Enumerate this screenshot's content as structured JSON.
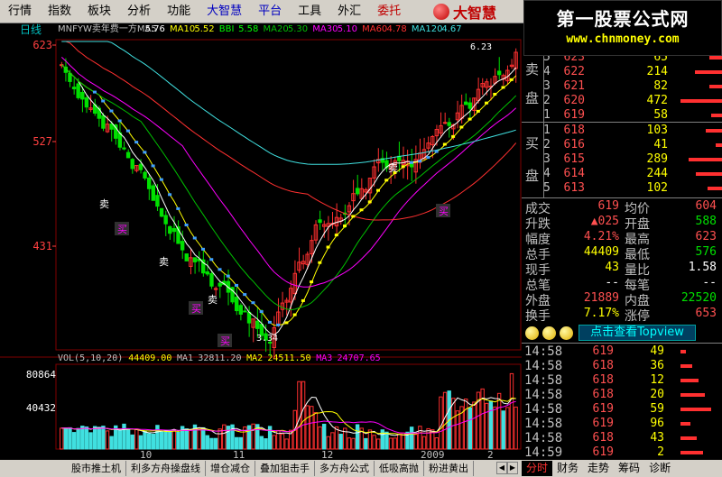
{
  "menu": {
    "items": [
      {
        "label": "行情",
        "style": ""
      },
      {
        "label": "指数",
        "style": ""
      },
      {
        "label": "板块",
        "style": ""
      },
      {
        "label": "分析",
        "style": ""
      },
      {
        "label": "功能",
        "style": ""
      },
      {
        "label": "大智慧",
        "style": "blue"
      },
      {
        "label": "平台",
        "style": "blue"
      },
      {
        "label": "工具",
        "style": ""
      },
      {
        "label": "外汇",
        "style": ""
      },
      {
        "label": "委托",
        "style": "red"
      }
    ],
    "brand": "大智慧"
  },
  "watermark": {
    "title": "第一股票公式网",
    "url": "www.chnmoney.com"
  },
  "chart": {
    "period_label": "日线",
    "indicator_header": [
      {
        "text": "MNFYW卖年费一方MA5",
        "color": "#c0c0c0"
      },
      {
        "text": "5.76",
        "color": "#ffffff"
      },
      {
        "text": "MA10",
        "color": "#ffff00"
      },
      {
        "text": "5.52",
        "color": "#ffff00"
      },
      {
        "text": "BBI",
        "color": "#00ff00"
      },
      {
        "text": "5.58",
        "color": "#00ff00"
      },
      {
        "text": "MA20",
        "color": "#00c000"
      },
      {
        "text": "5.30",
        "color": "#00c000"
      },
      {
        "text": "MA30",
        "color": "#ff00ff"
      },
      {
        "text": "5.10",
        "color": "#ff00ff"
      },
      {
        "text": "MA60",
        "color": "#ff3030"
      },
      {
        "text": "4.78",
        "color": "#ff3030"
      },
      {
        "text": "MA120",
        "color": "#40e0e0"
      },
      {
        "text": "4.67",
        "color": "#40e0e0"
      }
    ],
    "y_labels": [
      "623",
      "527",
      "431"
    ],
    "vol_labels": [
      "80864",
      "40432"
    ],
    "high_label": "6.23",
    "low_label": "3.34",
    "volume_header": [
      {
        "text": "VOL(5,10,20)",
        "color": "#c0c0c0"
      },
      {
        "text": "44409.00",
        "color": "#ffff00"
      },
      {
        "text": "MA1",
        "color": "#c0c0c0"
      },
      {
        "text": "32811.20",
        "color": "#c0c0c0"
      },
      {
        "text": "MA2",
        "color": "#ffff00"
      },
      {
        "text": "24511.50",
        "color": "#ffff00"
      },
      {
        "text": "MA3",
        "color": "#ff00ff"
      },
      {
        "text": "24707.65",
        "color": "#ff00ff"
      }
    ],
    "x_labels": [
      "10",
      "11",
      "12",
      "2009",
      "2"
    ],
    "signals": [
      {
        "text": "卖",
        "color": "#ffffff"
      },
      {
        "text": "买",
        "color": "#ff00ff"
      },
      {
        "text": "卖",
        "color": "#ffffff"
      },
      {
        "text": "买",
        "color": "#ff00ff"
      },
      {
        "text": "卖",
        "color": "#ffffff"
      },
      {
        "text": "买",
        "color": "#ff00ff"
      },
      {
        "text": "卖",
        "color": "#ffffff"
      },
      {
        "text": "买",
        "color": "#ff00ff"
      }
    ],
    "colors": {
      "up": "#ff3030",
      "down": "#00e000",
      "ma5": "#ffffff",
      "ma10": "#ffff00",
      "ma20": "#00c000",
      "ma30": "#ff00ff",
      "ma60": "#ff3030",
      "ma120": "#40e0e0"
    }
  },
  "orderbook": {
    "sell_label": [
      "卖",
      "盘"
    ],
    "buy_label": [
      "买",
      "盘"
    ],
    "sell": [
      {
        "level": "5",
        "price": "623",
        "vol": "65"
      },
      {
        "level": "4",
        "price": "622",
        "vol": "214"
      },
      {
        "level": "3",
        "price": "621",
        "vol": "82"
      },
      {
        "level": "2",
        "price": "620",
        "vol": "472"
      },
      {
        "level": "1",
        "price": "619",
        "vol": "58"
      }
    ],
    "buy": [
      {
        "level": "1",
        "price": "618",
        "vol": "103"
      },
      {
        "level": "2",
        "price": "616",
        "vol": "41"
      },
      {
        "level": "3",
        "price": "615",
        "vol": "289"
      },
      {
        "level": "4",
        "price": "614",
        "vol": "244"
      },
      {
        "level": "5",
        "price": "613",
        "vol": "102"
      }
    ],
    "sell_bars": [
      0.3,
      0.62,
      0.3,
      0.95,
      0.25
    ],
    "buy_bars": [
      0.38,
      0.15,
      0.78,
      0.6,
      0.33
    ]
  },
  "stats": [
    {
      "l1": "成交",
      "v1": "619",
      "c1": "up",
      "l2": "均价",
      "v2": "604",
      "c2": "up"
    },
    {
      "l1": "升跌",
      "v1": "▲025",
      "c1": "up",
      "l2": "开盘",
      "v2": "588",
      "c2": "down"
    },
    {
      "l1": "幅度",
      "v1": "4.21%",
      "c1": "up",
      "l2": "最高",
      "v2": "623",
      "c2": "up"
    },
    {
      "l1": "总手",
      "v1": "44409",
      "c1": "yellow",
      "l2": "最低",
      "v2": "576",
      "c2": "down"
    },
    {
      "l1": "现手",
      "v1": "43",
      "c1": "yellow",
      "l2": "量比",
      "v2": "1.58",
      "c2": "white"
    },
    {
      "l1": "总笔",
      "v1": "--",
      "c1": "white",
      "l2": "每笔",
      "v2": "--",
      "c2": "white"
    },
    {
      "l1": "外盘",
      "v1": "21889",
      "c1": "up",
      "l2": "内盘",
      "v2": "22520",
      "c2": "down"
    },
    {
      "l1": "换手",
      "v1": "7.17%",
      "c1": "yellow",
      "l2": "涨停",
      "v2": "653",
      "c2": "up"
    }
  ],
  "promo": {
    "label": "点击查看Topview"
  },
  "ticks": [
    {
      "time": "14:58",
      "price": "619",
      "dir": "up",
      "vol": "49"
    },
    {
      "time": "14:58",
      "price": "618",
      "dir": "up",
      "vol": "36"
    },
    {
      "time": "14:58",
      "price": "618",
      "dir": "up",
      "vol": "12"
    },
    {
      "time": "14:58",
      "price": "618",
      "dir": "up",
      "vol": "20"
    },
    {
      "time": "14:58",
      "price": "619",
      "dir": "up",
      "vol": "59"
    },
    {
      "time": "14:58",
      "price": "619",
      "dir": "up",
      "vol": "96"
    },
    {
      "time": "14:58",
      "price": "618",
      "dir": "up",
      "vol": "43"
    },
    {
      "time": "14:59",
      "price": "619",
      "dir": "up",
      "vol": "2"
    }
  ],
  "bottom_tabs": [
    "股市推土机",
    "利多方舟操盘线",
    "增仓减仓",
    "叠加狙击手",
    "多方舟公式",
    "低吸高抛",
    "粉进黄出"
  ],
  "right_tabs": [
    "分时",
    "财务",
    "走势",
    "筹码",
    "诊断"
  ]
}
